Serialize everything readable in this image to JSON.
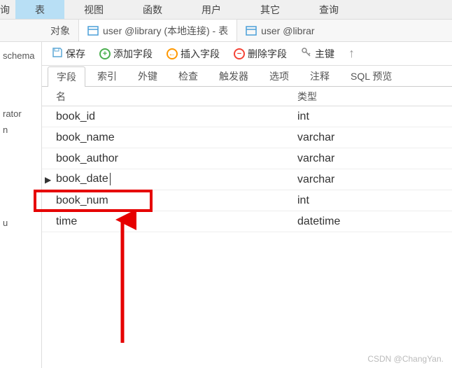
{
  "top_menu": {
    "items": [
      "询",
      "表",
      "视图",
      "函数",
      "用户",
      "其它",
      "查询"
    ]
  },
  "tabs": {
    "obj_label": "对象",
    "tab1_label": "user @library (本地连接) - 表",
    "tab2_label": "user @librar"
  },
  "sidebar": {
    "items": [
      "schema",
      "rator",
      "n",
      "u"
    ]
  },
  "toolbar": {
    "save_label": "保存",
    "add_label": "添加字段",
    "insert_label": "插入字段",
    "delete_label": "删除字段",
    "pkey_label": "主键"
  },
  "sub_tabs": {
    "items": [
      "字段",
      "索引",
      "外键",
      "检查",
      "触发器",
      "选项",
      "注释",
      "SQL 预览"
    ]
  },
  "table": {
    "header_name": "名",
    "header_type": "类型",
    "rows": [
      {
        "name": "book_id",
        "type": "int",
        "editing": false
      },
      {
        "name": "book_name",
        "type": "varchar",
        "editing": false
      },
      {
        "name": "book_author",
        "type": "varchar",
        "editing": false
      },
      {
        "name": "book_date",
        "type": "varchar",
        "editing": true
      },
      {
        "name": "book_num",
        "type": "int",
        "editing": false
      },
      {
        "name": "time",
        "type": "datetime",
        "editing": false
      }
    ]
  },
  "watermark": "CSDN @ChangYan."
}
